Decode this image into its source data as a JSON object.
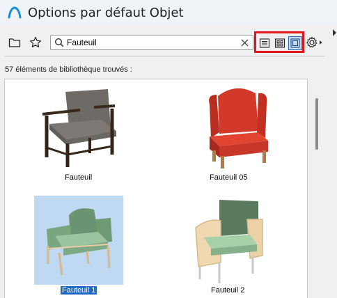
{
  "window": {
    "title": "Options par défaut Objet"
  },
  "toolbar": {
    "folder_icon": "folder-icon",
    "favorites_icon": "star-icon",
    "search": {
      "value": "Fauteuil",
      "placeholder": ""
    },
    "view_modes": [
      "list-view",
      "grid-view",
      "large-preview-view"
    ],
    "active_view": "large-preview-view",
    "highlight_color": "#e3141a"
  },
  "results": {
    "count_label": "57 éléments de bibliothèque trouvés :"
  },
  "items": [
    {
      "label": "Fauteuil",
      "selected": false
    },
    {
      "label": "Fauteuil 05",
      "selected": false
    },
    {
      "label": "Fauteuil 1",
      "selected": true
    },
    {
      "label": "Fauteuil 2",
      "selected": false
    }
  ],
  "colors": {
    "selection": "#1e6cc6",
    "selection_bg": "#bfd9f2",
    "accent": "#2a6bb8"
  }
}
